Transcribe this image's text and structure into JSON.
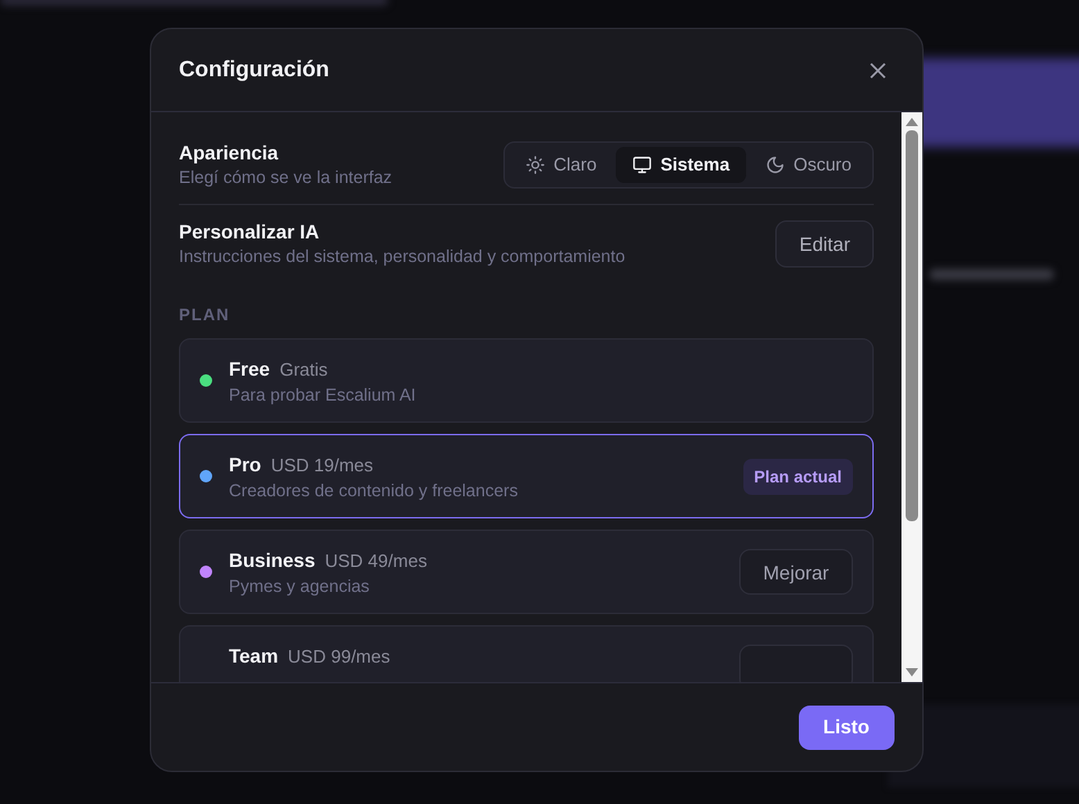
{
  "dialog": {
    "title": "Configuración"
  },
  "appearance": {
    "label": "Apariencia",
    "description": "Elegí cómo se ve la interfaz",
    "options": [
      {
        "kind": "light",
        "label": "Claro",
        "selected": false
      },
      {
        "kind": "system",
        "label": "Sistema",
        "selected": true
      },
      {
        "kind": "dark",
        "label": "Oscuro",
        "selected": false
      }
    ]
  },
  "personalize": {
    "label": "Personalizar IA",
    "description": "Instrucciones del sistema, personalidad y comportamiento",
    "button": "Editar"
  },
  "plan": {
    "heading": "PLAN",
    "plans": [
      {
        "name": "Free",
        "price": "Gratis",
        "description": "Para probar Escalium AI",
        "color": "#4ade80",
        "selected": false
      },
      {
        "name": "Pro",
        "price": "USD 19/mes",
        "description": "Creadores de contenido y freelancers",
        "color": "#60a5fa",
        "selected": true,
        "action": {
          "kind": "badge",
          "label": "Plan actual"
        }
      },
      {
        "name": "Business",
        "price": "USD 49/mes",
        "description": "Pymes y agencias",
        "color": "#c084fc",
        "selected": false,
        "action": {
          "kind": "button",
          "label": "Mejorar"
        }
      },
      {
        "name": "Team",
        "price": "USD 99/mes",
        "selected": false,
        "action": {
          "kind": "button"
        }
      }
    ]
  },
  "footer": {
    "button": "Listo"
  }
}
